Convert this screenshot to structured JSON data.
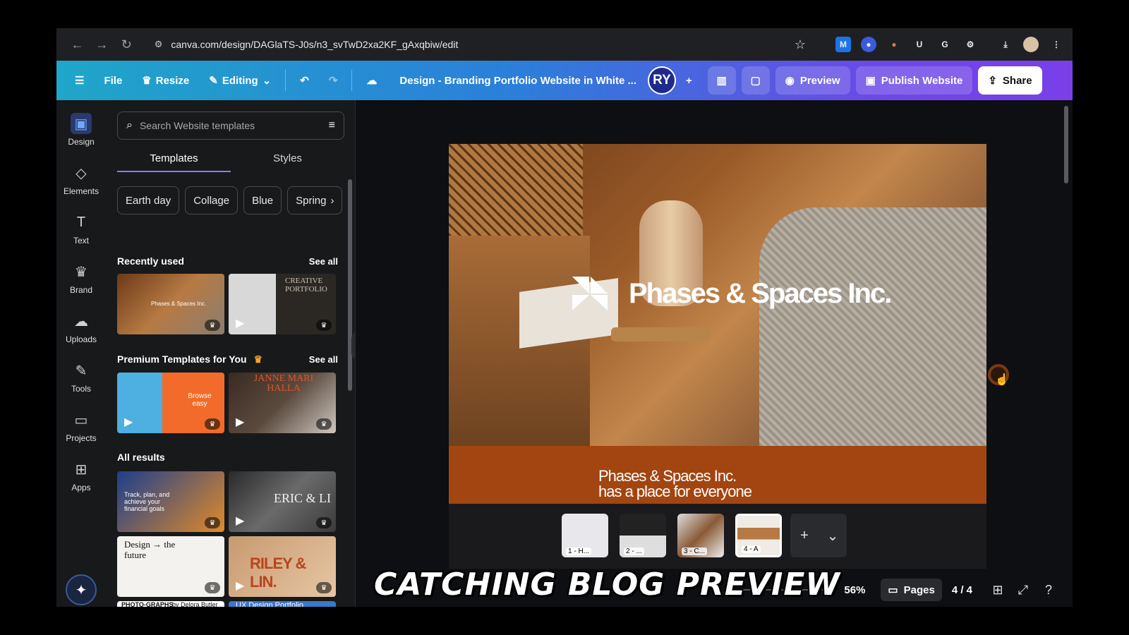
{
  "browser": {
    "url": "canva.com/design/DAGlaTS-J0s/n3_svTwD2xa2KF_gAxqbiw/edit",
    "extensions": [
      {
        "name": "m-icon",
        "label": "M",
        "color": "#1a73e8"
      },
      {
        "name": "extension-blue-icon",
        "label": "●",
        "color": "#3b5bdb"
      },
      {
        "name": "extension-orange-icon",
        "label": "●",
        "color": "#c0622a"
      },
      {
        "name": "u-icon",
        "label": "U",
        "color": "#2b2c30"
      },
      {
        "name": "grammarly-icon",
        "label": "G",
        "color": "#2b2c30"
      },
      {
        "name": "puzzle-icon",
        "label": "⚙",
        "color": "#2b2c30"
      }
    ]
  },
  "toolbar": {
    "file": "File",
    "resize": "Resize",
    "editing": "Editing",
    "title": "Design - Branding Portfolio Website in White ...",
    "avatar": "RY",
    "preview": "Preview",
    "publish": "Publish Website",
    "share": "Share"
  },
  "rail": [
    {
      "label": "Design",
      "icon": "▣"
    },
    {
      "label": "Elements",
      "icon": "◇"
    },
    {
      "label": "Text",
      "icon": "T"
    },
    {
      "label": "Brand",
      "icon": "♛"
    },
    {
      "label": "Uploads",
      "icon": "☁"
    },
    {
      "label": "Tools",
      "icon": "✎"
    },
    {
      "label": "Projects",
      "icon": "▭"
    },
    {
      "label": "Apps",
      "icon": "⊞"
    }
  ],
  "panel": {
    "search_placeholder": "Search Website templates",
    "tabs": [
      "Templates",
      "Styles"
    ],
    "chips": [
      "Earth day",
      "Collage",
      "Blue",
      "Spring"
    ],
    "recently_used": "Recently used",
    "premium": "Premium Templates for You",
    "all_results": "All results",
    "see_all": "See all",
    "thumb_texts": {
      "phases": "Phases & Spaces Inc.",
      "creative": "CREATIVE PORTFOLIO",
      "browse": "Browse easy",
      "janne": "JANNE MARI HALLA",
      "track": "Track, plan, and achieve your financial goals",
      "eric": "ERIC & LI",
      "design_future": "Design → the future",
      "riley": "RILEY & LIN.",
      "photographs": "PHOTO-GRAPHS",
      "delora": "by Delora Butler",
      "ux": "UX Design Portfolio"
    }
  },
  "canvas": {
    "brand": "Phases & Spaces Inc.",
    "band_line1": "Phases & Spaces Inc.",
    "band_line2": "has a place for everyone",
    "pages": [
      "1 - H...",
      "2 - ...",
      "3 - C...",
      "4 - A"
    ]
  },
  "bottom": {
    "zoom": "56%",
    "pages": "Pages",
    "page_count": "4 / 4"
  },
  "caption": "CATCHING BLOG PREVIEW"
}
